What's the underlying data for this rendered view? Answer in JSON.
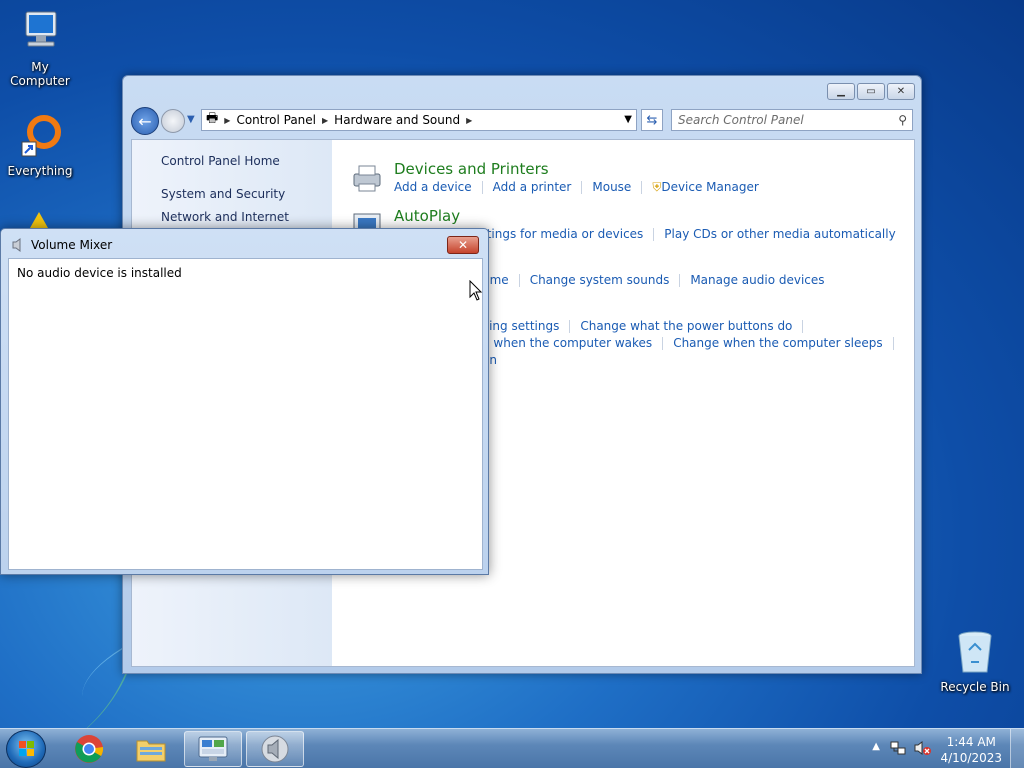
{
  "desktop": {
    "icons": [
      {
        "label": "My Computer"
      },
      {
        "label": "Everything"
      },
      {
        "label": "Recycle Bin"
      }
    ]
  },
  "control_panel": {
    "address": {
      "crumbs": [
        "Control Panel",
        "Hardware and Sound"
      ]
    },
    "search_placeholder": "Search Control Panel",
    "left_nav": [
      "Control Panel Home",
      "System and Security",
      "Network and Internet"
    ],
    "categories": [
      {
        "title": "Devices and Printers",
        "links": [
          "Add a device",
          "Add a printer",
          "Mouse",
          "Device Manager"
        ]
      },
      {
        "title": "AutoPlay",
        "links": [
          "ttings for media or devices",
          "Play CDs or other media automatically"
        ]
      },
      {
        "title": "",
        "links": [
          "ume",
          "Change system sounds",
          "Manage audio devices"
        ]
      },
      {
        "title": "s",
        "links": [
          "ving settings",
          "Change what the power buttons do"
        ]
      },
      {
        "title": "",
        "links": [
          "d when the computer wakes",
          "Change when the computer sleeps"
        ]
      },
      {
        "title": "",
        "links": [
          "an"
        ]
      }
    ]
  },
  "volume_mixer": {
    "title": "Volume Mixer",
    "message": "No audio device is installed"
  },
  "taskbar": {
    "time": "1:44 AM",
    "date": "4/10/2023"
  }
}
